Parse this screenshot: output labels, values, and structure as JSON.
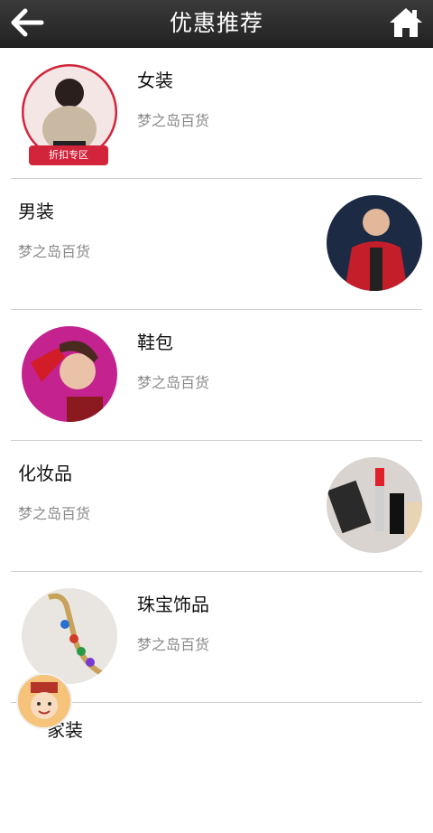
{
  "header": {
    "title": "优惠推荐",
    "back_icon": "back-arrow-icon",
    "home_icon": "home-icon"
  },
  "items": [
    {
      "name": "女装",
      "sub": "梦之岛百货",
      "badge": "折扣专区"
    },
    {
      "name": "男装",
      "sub": "梦之岛百货"
    },
    {
      "name": "鞋包",
      "sub": "梦之岛百货"
    },
    {
      "name": "化妆品",
      "sub": "梦之岛百货"
    },
    {
      "name": "珠宝饰品",
      "sub": "梦之岛百货"
    },
    {
      "name": "家装"
    }
  ],
  "colors": {
    "header_bg": "#2b2b2b",
    "badge_bg": "#d2243b",
    "sub_text": "#8a8a8a"
  }
}
